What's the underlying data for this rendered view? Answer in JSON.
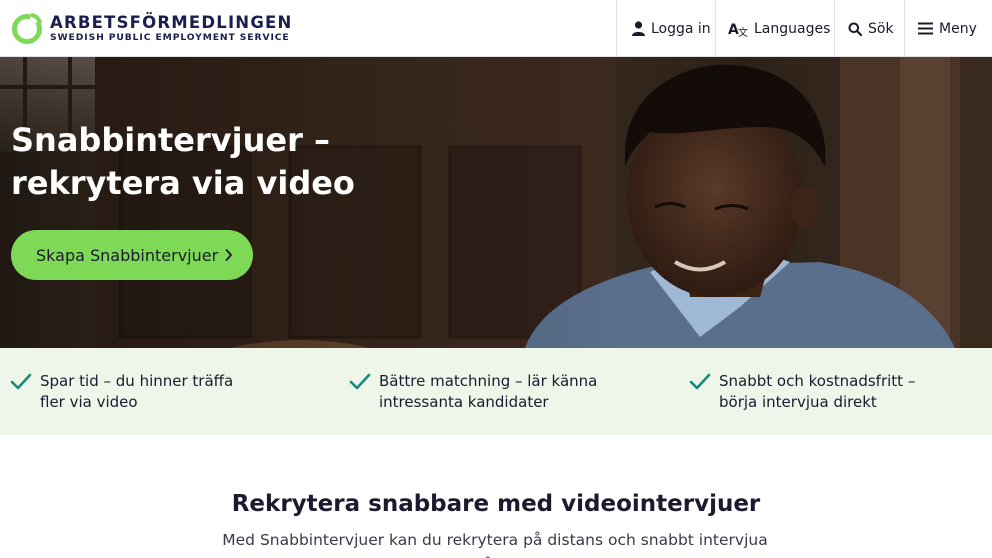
{
  "header": {
    "logo_name": "ARBETSFÖRMEDLINGEN",
    "logo_sub": "SWEDISH PUBLIC EMPLOYMENT SERVICE",
    "nav": {
      "login": "Logga in",
      "languages": "Languages",
      "search": "Sök",
      "menu": "Meny"
    }
  },
  "hero": {
    "title_line1": "Snabbintervjuer –",
    "title_line2": "rekrytera via video",
    "cta_label": "Skapa Snabbintervjuer"
  },
  "benefits": [
    {
      "line1": "Spar tid – du hinner träffa",
      "line2": "fler via video"
    },
    {
      "line1": "Bättre matchning – lär känna",
      "line2": "intressanta kandidater"
    },
    {
      "line1": "Snabbt och kostnadsfritt –",
      "line2": "börja intervjua direkt"
    }
  ],
  "intro": {
    "title": "Rekrytera snabbare med videointervjuer",
    "text": "Med Snabbintervjuer kan du rekrytera på distans och snabbt intervjua många"
  },
  "colors": {
    "brand_green": "#7ed957",
    "brand_navy": "#1b1f4d",
    "check_teal": "#1a8a7a",
    "benefit_bg": "#eef6ea"
  }
}
